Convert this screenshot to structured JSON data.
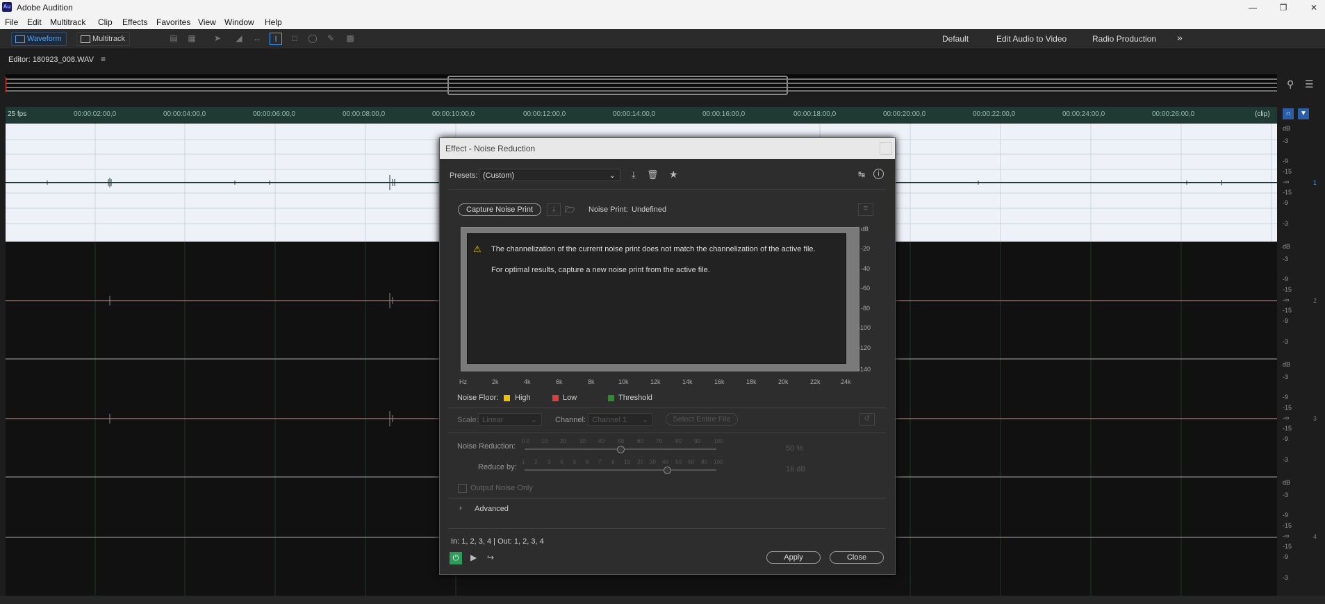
{
  "app": {
    "title": "Adobe Audition",
    "logo_text": "Au"
  },
  "menu": [
    "File",
    "Edit",
    "Multitrack",
    "Clip",
    "Effects",
    "Favorites",
    "View",
    "Window",
    "Help"
  ],
  "toolbar": {
    "waveform_label": "Waveform",
    "multitrack_label": "Multitrack"
  },
  "workspaces": [
    "Default",
    "Edit Audio to Video",
    "Radio Production"
  ],
  "editor": {
    "tab_label": "Editor: 180923_008.WAV"
  },
  "timeline": {
    "start_label": "25 fps",
    "end_label": "(clip)",
    "ticks": [
      "00:00:02:00,0",
      "00:00:04:00,0",
      "00:00:06:00,0",
      "00:00:08:00,0",
      "00:00:10:00,0",
      "00:00:12:00,0",
      "00:00:14:00,0",
      "00:00:16:00,0",
      "00:00:18:00,0",
      "00:00:20:00,0",
      "00:00:22:00,0",
      "00:00:24:00,0",
      "00:00:26:00,0"
    ]
  },
  "tracks": {
    "db_labels": [
      "dB",
      "-3",
      "-9",
      "-15",
      "-∞",
      "-15",
      "-9",
      "-3"
    ],
    "channels": [
      "1",
      "2",
      "3",
      "4"
    ]
  },
  "dialog": {
    "title": "Effect - Noise Reduction",
    "presets_label": "Presets:",
    "preset_value": "(Custom)",
    "capture_button": "Capture Noise Print",
    "noise_print_label": "Noise Print:",
    "noise_print_value": "Undefined",
    "warning_line1": "The channelization of the current noise print does not match the channelization of the active file.",
    "warning_line2": "For optimal results, capture a new noise print from the active file.",
    "graph_db_unit": "dB",
    "graph_db_ticks": [
      "-20",
      "-40",
      "-60",
      "-80",
      "-100",
      "-120",
      "-140"
    ],
    "graph_hz_ticks": [
      "Hz",
      "2k",
      "4k",
      "6k",
      "8k",
      "10k",
      "12k",
      "14k",
      "16k",
      "18k",
      "20k",
      "22k",
      "24k"
    ],
    "noise_floor_label": "Noise Floor:",
    "legend": [
      {
        "label": "High",
        "color": "#f0c000"
      },
      {
        "label": "Low",
        "color": "#e03c3c"
      },
      {
        "label": "Threshold",
        "color": "#2e8b2e"
      }
    ],
    "scale_label": "Scale:",
    "scale_value": "Linear",
    "channel_label": "Channel:",
    "channel_value": "Channel 1",
    "select_entire_file": "Select Entire File",
    "noise_reduction_label": "Noise Reduction:",
    "noise_reduction_ticks": [
      "0 0",
      "10",
      "20",
      "30",
      "40",
      "50",
      "60",
      "70",
      "80",
      "90",
      "100"
    ],
    "noise_reduction_value": "50 %",
    "noise_reduction_level": 50,
    "reduce_by_label": "Reduce by:",
    "reduce_by_ticks": [
      "1",
      "2",
      "3",
      "4",
      "5",
      "6",
      "7",
      "8",
      "10",
      "20",
      "30",
      "40",
      "50",
      "60",
      "80",
      "100"
    ],
    "reduce_by_value": "16 dB",
    "output_noise_only": "Output Noise Only",
    "advanced_label": "Advanced",
    "io_label": "In: 1, 2, 3, 4 | Out: 1, 2, 3, 4",
    "apply_button": "Apply",
    "close_button": "Close"
  }
}
